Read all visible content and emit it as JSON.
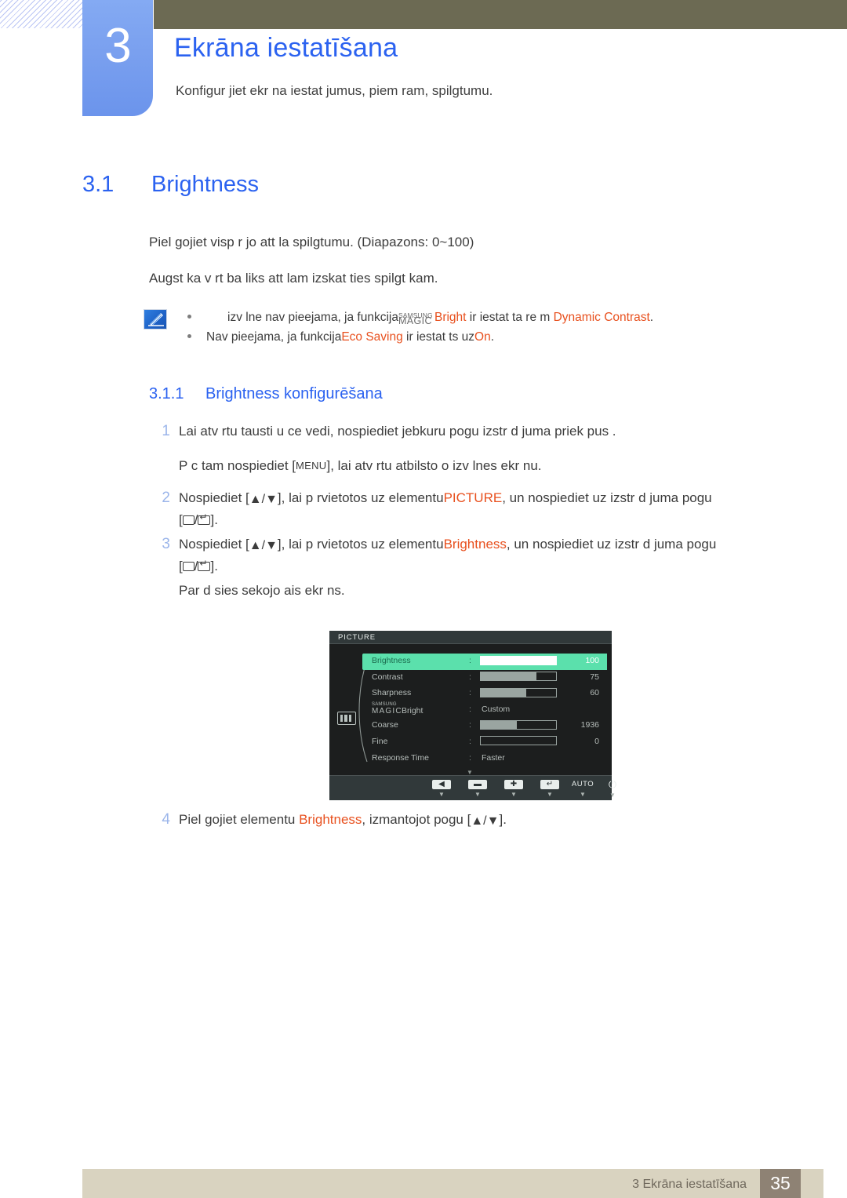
{
  "header": {
    "chapter_number": "3",
    "chapter_title": "Ekrāna iestatīšana",
    "chapter_desc": "Konfigur jiet ekr na iestat jumus, piem ram, spilgtumu."
  },
  "section": {
    "number": "3.1",
    "title": "Brightness",
    "para1": "Piel gojiet visp r jo att la spilgtumu. (Diapazons: 0~100)",
    "para2": "Augst ka v rt ba liks att  lam izskat ties spilgt kam."
  },
  "note": {
    "icon": "note-pen-icon",
    "row1": {
      "pre": "izv lne nav pieejama, ja funkcija",
      "magic_top": "SAMSUNG",
      "magic_bottom": "MAGIC",
      "magic_word": "Bright",
      "mid": " ir iestat ta re  m ",
      "highlight": "Dynamic Contrast",
      "post": "."
    },
    "row2": {
      "pre": "Nav pieejama, ja funkcija",
      "highlight1": "Eco Saving",
      "mid": " ir iestat ts uz",
      "highlight2": "On",
      "post": "."
    }
  },
  "subsection": {
    "number": "3.1.1",
    "title": "Brightness konfigurēšana"
  },
  "steps": {
    "s1_num": "1",
    "s1_text": "Lai atv rtu tausti u ce vedi, nospiediet jebkuru pogu izstr d juma priek pus .",
    "s1b_text_a": "P c tam nospiediet [",
    "s1b_menu": "MENU",
    "s1b_text_b": "], lai atv rtu atbilsto o izv lnes ekr nu.",
    "s2_num": "2",
    "s2_a": "Nospiediet [",
    "s2_arrows": "▲/▼",
    "s2_b": "], lai p rvietotos uz elementu",
    "s2_highlight": "PICTURE",
    "s2_c": ", un nospiediet uz izstr d juma pogu",
    "s2_d": "[",
    "s2_e": "].",
    "s3_num": "3",
    "s3_a": "Nospiediet [",
    "s3_arrows": "▲/▼",
    "s3_b": "], lai p rvietotos uz elementu",
    "s3_highlight": "Brightness",
    "s3_c": ", un nospiediet uz izstr d juma pogu",
    "s3_d": "[",
    "s3_e": "].",
    "s3b_text": "Par d sies sekojo ais ekr ns.",
    "s4_num": "4",
    "s4_a": "Piel gojiet elementu ",
    "s4_highlight": "Brightness",
    "s4_b": ", izmantojot pogu [",
    "s4_arrows": "▲/▼",
    "s4_c": "]."
  },
  "osd": {
    "title": "PICTURE",
    "side_icon": "picture-bars-icon",
    "down_arrow": "▼",
    "rows": [
      {
        "label": "Brightness",
        "colon": ":",
        "type": "bar",
        "percent": 100,
        "value": "100",
        "active": true
      },
      {
        "label": "Contrast",
        "colon": ":",
        "type": "bar",
        "percent": 74,
        "value": "75",
        "active": false
      },
      {
        "label": "Sharpness",
        "colon": ":",
        "type": "bar",
        "percent": 60,
        "value": "60",
        "active": false
      },
      {
        "label": "MAGIC Bright",
        "magic_top": "SAMSUNG",
        "magic_bottom": "MAGIC",
        "magic_word": "Bright",
        "colon": ":",
        "type": "text",
        "value": "Custom",
        "active": false
      },
      {
        "label": "Coarse",
        "colon": ":",
        "type": "bar",
        "percent": 48,
        "value": "1936",
        "active": false
      },
      {
        "label": "Fine",
        "colon": ":",
        "type": "bar",
        "percent": 0,
        "value": "0",
        "active": false
      },
      {
        "label": "Response Time",
        "colon": ":",
        "type": "text",
        "value": "Faster",
        "active": false
      }
    ],
    "buttons": [
      {
        "icon": "◀",
        "name": "back-button",
        "caret": "▼"
      },
      {
        "icon": "▬",
        "name": "minus-button",
        "caret": "▼"
      },
      {
        "icon": "✚",
        "name": "plus-button",
        "caret": "▼"
      },
      {
        "icon": "↵",
        "name": "enter-button",
        "caret": "▼"
      },
      {
        "icon": "AUTO",
        "name": "auto-button",
        "caret": "▼"
      },
      {
        "icon": "⏻",
        "name": "power-button",
        "caret": "▼"
      }
    ]
  },
  "footer": {
    "text": "3 Ekrāna iestatīšana",
    "page": "35"
  },
  "colors": {
    "accent_blue": "#2b62f0",
    "tab_blue": "#7aa0ef",
    "olive": "#6c6a53",
    "orange": "#e8501e",
    "osd_green": "#5be0ac",
    "footer_beige": "#d9d3c0",
    "footer_page": "#8e8274"
  }
}
